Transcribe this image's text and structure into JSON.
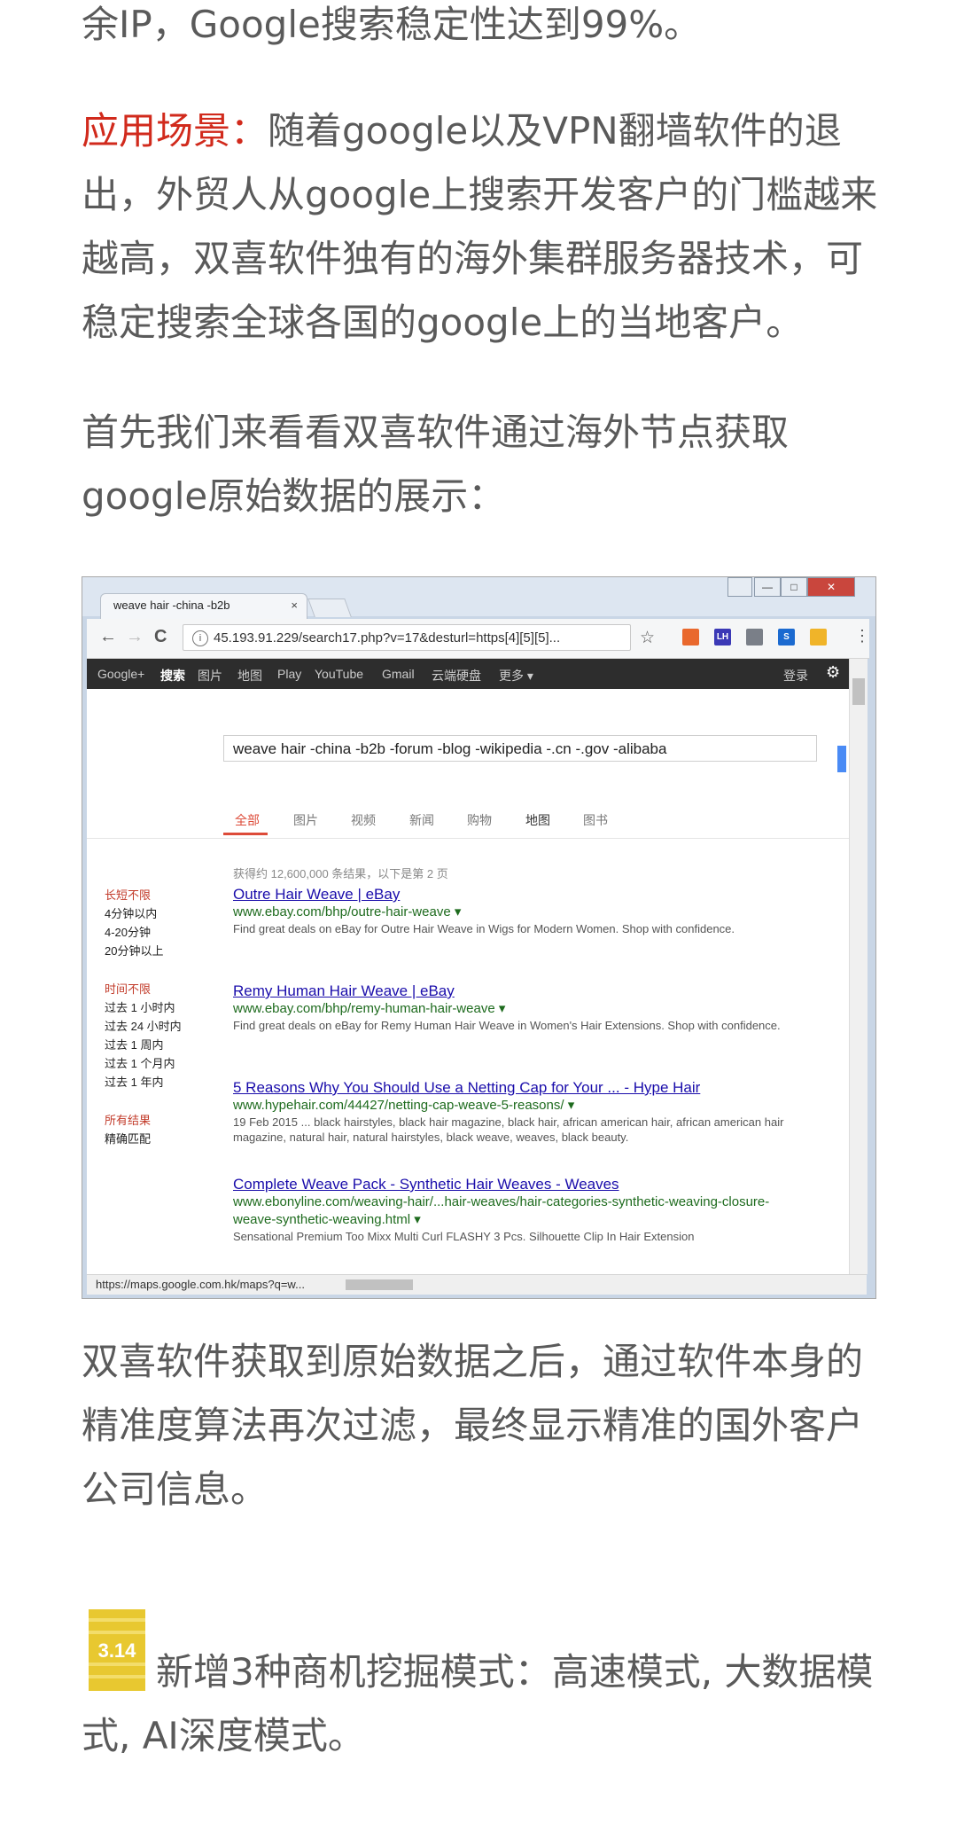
{
  "paragraphs": {
    "p1": "余IP，Google搜索稳定性达到99%。",
    "p2_label": "应用场景：",
    "p2_text": "随着google以及VPN翻墙软件的退出，外贸人从google上搜索开发客户的门槛越来越高，双喜软件独有的海外集群服务器技术，可稳定搜索全球各国的google上的当地客户。",
    "p3": "首先我们来看看双喜软件通过海外节点获取google原始数据的展示：",
    "p4": "双喜软件获取到原始数据之后，通过软件本身的精准度算法再次过滤，最终显示精准的国外客户公司信息。",
    "p5": "新增3种商机挖掘模式：高速模式, 大数据模式, AI深度模式。"
  },
  "browser": {
    "tab_title": "weave hair -china -b2b",
    "tab_close": "×",
    "url": "45.193.91.229/search17.php?v=17&desturl=https[4][5][5]...",
    "nav": {
      "back": "←",
      "forward": "→",
      "reload": "C"
    },
    "win": {
      "min": "—",
      "max": "□",
      "close": "✕"
    },
    "extensions": [
      {
        "label": "",
        "color": "#e9682d"
      },
      {
        "label": "LH",
        "color": "#3b39b6"
      },
      {
        "label": "",
        "color": "#7a7f88"
      },
      {
        "label": "S",
        "color": "#1b6ad0"
      },
      {
        "label": "",
        "color": "#f0b429"
      }
    ],
    "status_url": "https://maps.google.com.hk/maps?q=w..."
  },
  "google": {
    "bar": [
      "Google+",
      "搜索",
      "图片",
      "地图",
      "Play",
      "YouTube",
      "Gmail",
      "云端硬盘",
      "更多 ▾"
    ],
    "login": "登录",
    "query": "weave hair -china -b2b -forum -blog -wikipedia -.cn -.gov -alibaba",
    "tabs": [
      "全部",
      "图片",
      "视频",
      "新闻",
      "购物",
      "地图",
      "图书"
    ],
    "stats": "获得约 12,600,000 条结果，以下是第 2 页",
    "sidebar": {
      "g1_title": "长短不限",
      "g1": [
        "4分钟以内",
        "4-20分钟",
        "20分钟以上"
      ],
      "g2_title": "时间不限",
      "g2": [
        "过去 1 小时内",
        "过去 24 小时内",
        "过去 1 周内",
        "过去 1 个月内",
        "过去 1 年内"
      ],
      "g3_title": "所有结果",
      "g3": [
        "精确匹配"
      ]
    },
    "results": [
      {
        "title": "Outre Hair Weave | eBay",
        "url": "www.ebay.com/bhp/outre-hair-weave ▾",
        "desc": "Find great deals on eBay for Outre Hair Weave in Wigs for Modern Women. Shop with confidence."
      },
      {
        "title": "Remy Human Hair Weave | eBay",
        "url": "www.ebay.com/bhp/remy-human-hair-weave ▾",
        "desc": "Find great deals on eBay for Remy Human Hair Weave in Women's Hair Extensions. Shop with confidence."
      },
      {
        "title": "5 Reasons Why You Should Use a Netting Cap for Your ... - Hype Hair",
        "url": "www.hypehair.com/44427/netting-cap-weave-5-reasons/ ▾",
        "desc": "19 Feb 2015 ... black hairstyles, black hair magazine, black hair, african american hair, african american hair magazine, natural hair, natural hairstyles, black weave, weaves, black beauty."
      },
      {
        "title": "Complete Weave Pack - Synthetic Hair Weaves - Weaves",
        "url": "www.ebonyline.com/weaving-hair/...hair-weaves/hair-categories-synthetic-weaving-closure-weave-synthetic-weaving.html ▾",
        "desc": "Sensational Premium Too Mixx Multi Curl FLASHY 3 Pcs. Silhouette Clip In Hair Extension"
      }
    ]
  },
  "chip_numbers": "3.14"
}
